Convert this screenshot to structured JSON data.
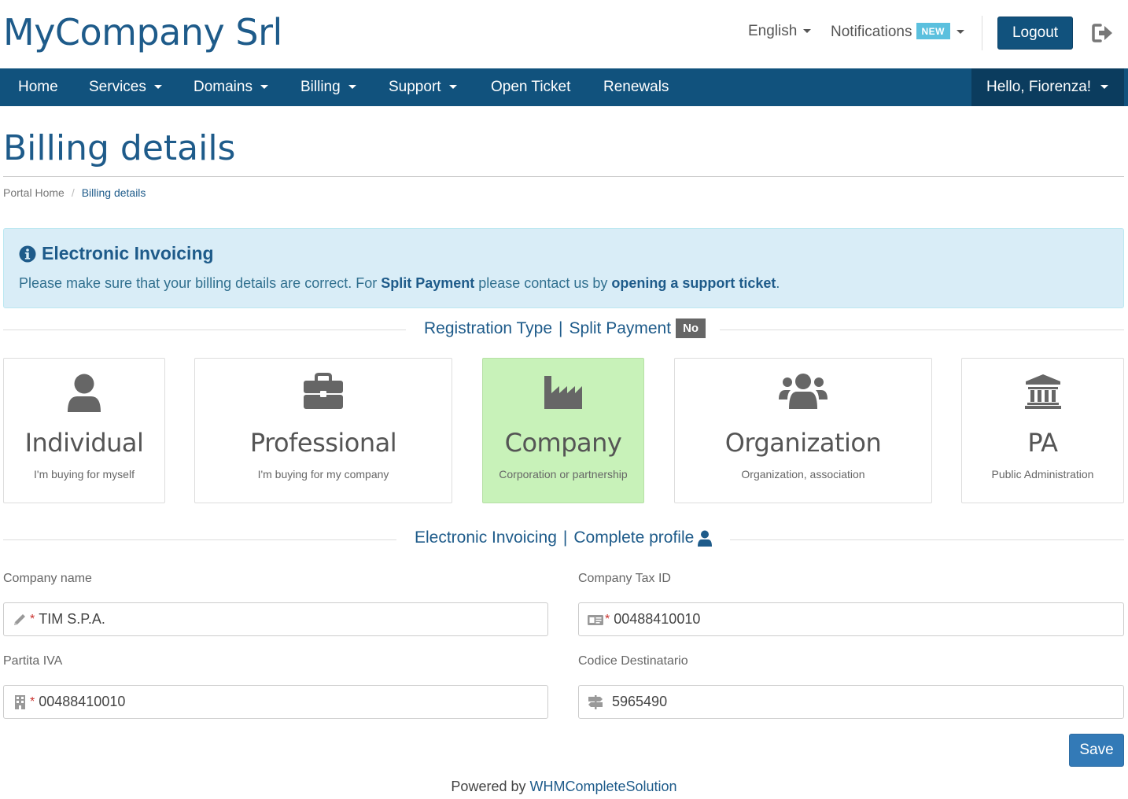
{
  "header": {
    "brand": "MyCompany Srl",
    "language": "English",
    "notifications": "Notifications",
    "notifications_badge": "NEW",
    "logout": "Logout"
  },
  "nav": {
    "items": [
      {
        "label": "Home",
        "dropdown": false
      },
      {
        "label": "Services",
        "dropdown": true
      },
      {
        "label": "Domains",
        "dropdown": true
      },
      {
        "label": "Billing",
        "dropdown": true
      },
      {
        "label": "Support",
        "dropdown": true
      },
      {
        "label": "Open Ticket",
        "dropdown": false
      },
      {
        "label": "Renewals",
        "dropdown": false
      }
    ],
    "user_greeting": "Hello, Fiorenza!"
  },
  "page": {
    "title": "Billing details",
    "breadcrumb": [
      "Portal Home",
      "Billing details"
    ]
  },
  "alert": {
    "title": "Electronic Invoicing",
    "text_before": "Please make sure that your billing details are correct. For ",
    "bold_text": "Split Payment",
    "text_middle": " please contact us by ",
    "link_text": "opening a support ticket",
    "text_after": "."
  },
  "registration": {
    "heading": "Registration Type",
    "split_payment_label": "Split Payment",
    "split_payment_value": "No",
    "selected": "Company",
    "types": [
      {
        "title": "Individual",
        "subtitle": "I'm buying for myself",
        "icon": "user-icon"
      },
      {
        "title": "Professional",
        "subtitle": "I'm buying for my company",
        "icon": "briefcase-icon"
      },
      {
        "title": "Company",
        "subtitle": "Corporation or partnership",
        "icon": "factory-icon"
      },
      {
        "title": "Organization",
        "subtitle": "Organization, association",
        "icon": "users-icon"
      },
      {
        "title": "PA",
        "subtitle": "Public Administration",
        "icon": "university-icon"
      }
    ]
  },
  "profile": {
    "heading": "Electronic Invoicing",
    "complete_label": "Complete profile"
  },
  "form": {
    "company_name": {
      "label": "Company name",
      "value": "TIM S.P.A.",
      "required": "*"
    },
    "company_tax_id": {
      "label": "Company Tax ID",
      "value": "00488410010",
      "required": "*"
    },
    "partita_iva": {
      "label": "Partita IVA",
      "value": "00488410010",
      "required": "*"
    },
    "codice_destinatario": {
      "label": "Codice Destinatario",
      "value": "5965490"
    },
    "save": "Save"
  },
  "footer": {
    "prefix": "Powered by ",
    "link": "WHMCompleteSolution"
  },
  "colors": {
    "brand": "#1e5b8a",
    "navbar": "#11527d",
    "selected_card": "#c8f2b9",
    "alert_bg": "#d9edf7",
    "save_button": "#337ab7"
  }
}
